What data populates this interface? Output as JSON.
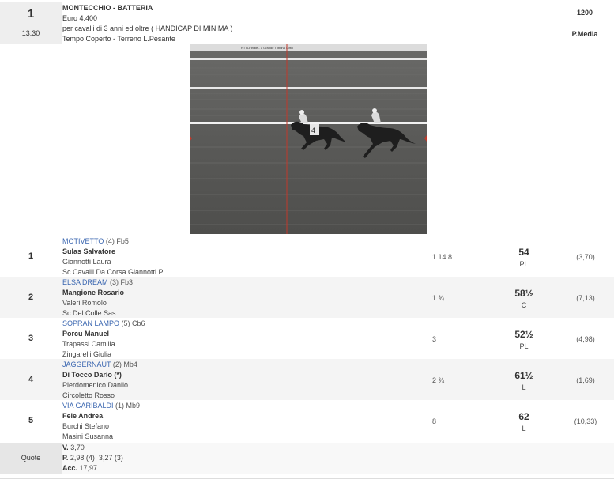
{
  "race": {
    "number": "1",
    "time": "13.30",
    "title": "MONTECCHIO - BATTERIA",
    "prize": "Euro 4.400",
    "conditions": "per cavalli di 3 anni ed oltre ( HANDICAP DI MINIMA )",
    "weather": "Tempo Coperto - Terreno L.Pesante",
    "distance": "1200",
    "going": "P.Media"
  },
  "photo": {
    "caption": "RT B-Finale - 1 Grande Tribuna Lotto"
  },
  "results": [
    {
      "pos": "1",
      "horse": "MOTIVETTO",
      "extra": "(4) Fb5",
      "jockey": "Sulas Salvatore",
      "trainer": "Giannotti Laura",
      "owner": "Sc Cavalli Da Corsa Giannotti P.",
      "time": "1.14.8",
      "weight": "54",
      "wclass": "PL",
      "odds": "(3,70)"
    },
    {
      "pos": "2",
      "horse": "ELSA DREAM",
      "extra": "(3) Fb3",
      "jockey": "Mangione Rosario",
      "trainer": "Valeri Romolo",
      "owner": "Sc Del Colle Sas",
      "time": "1 ¾",
      "weight": "58½",
      "wclass": "C",
      "odds": "(7,13)"
    },
    {
      "pos": "3",
      "horse": "SOPRAN LAMPO",
      "extra": "(5) Cb6",
      "jockey": "Porcu Manuel",
      "trainer": "Trapassi Camilla",
      "owner": "Zingarelli Giulia",
      "time": "3",
      "weight": "52½",
      "wclass": "PL",
      "odds": "(4,98)"
    },
    {
      "pos": "4",
      "horse": "JAGGERNAUT",
      "extra": "(2) Mb4",
      "jockey": "Di Tocco Dario (*)",
      "trainer": "Pierdomenico Danilo",
      "owner": "Circoletto Rosso",
      "time": "2 ¾",
      "weight": "61½",
      "wclass": "L",
      "odds": "(1,69)"
    },
    {
      "pos": "5",
      "horse": "VIA GARIBALDI",
      "extra": "(1) Mb9",
      "jockey": "Fele Andrea",
      "trainer": "Burchi Stefano",
      "owner": "Masini Susanna",
      "time": "8",
      "weight": "62",
      "wclass": "L",
      "odds": "(10,33)"
    }
  ],
  "quote": {
    "label": "Quote",
    "v_label": "V.",
    "v_value": "3,70",
    "p_label": "P.",
    "p_value": "2,98 (4)  3,27 (3)",
    "acc_label": "Acc.",
    "acc_value": "17,97"
  }
}
